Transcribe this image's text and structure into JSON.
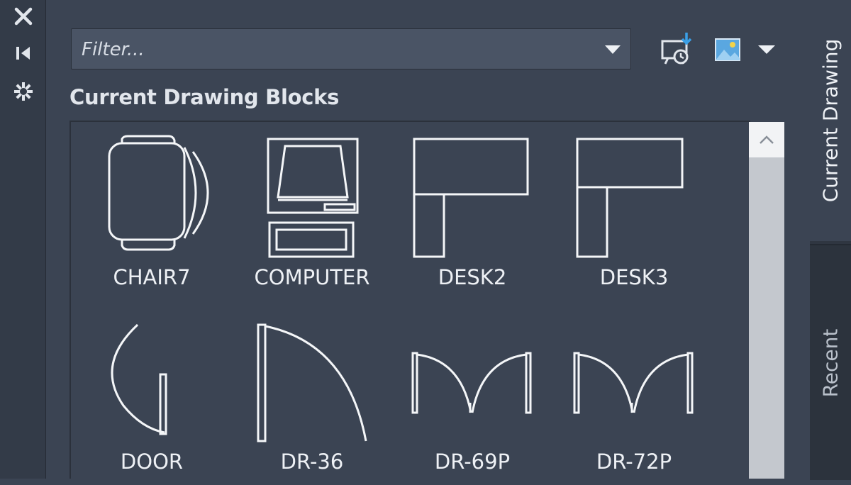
{
  "toolbar": {
    "icons": [
      "close-icon",
      "pin-icon",
      "settings-icon"
    ]
  },
  "filter": {
    "placeholder": "Filter...",
    "value": ""
  },
  "header_icons": [
    "insert-block-icon",
    "thumbnail-view-icon",
    "view-options-dropdown-icon"
  ],
  "section": {
    "title": "Current Drawing Blocks"
  },
  "blocks": [
    {
      "name": "CHAIR7"
    },
    {
      "name": "COMPUTER"
    },
    {
      "name": "DESK2"
    },
    {
      "name": "DESK3"
    },
    {
      "name": "DOOR"
    },
    {
      "name": "DR-36"
    },
    {
      "name": "DR-69P"
    },
    {
      "name": "DR-72P"
    }
  ],
  "tabs": [
    {
      "label": "Current Drawing",
      "active": true
    },
    {
      "label": "Recent",
      "active": false
    }
  ],
  "colors": {
    "background": "#3b4453",
    "sidebar": "#333b48",
    "input": "#4a5465",
    "text": "#e8ecf2",
    "accent_blue": "#3aa0e8"
  }
}
